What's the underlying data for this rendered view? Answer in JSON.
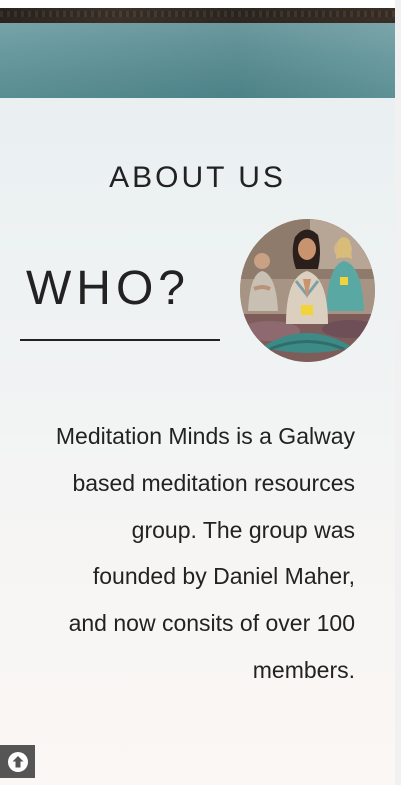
{
  "about": {
    "section_title": "ABOUT US",
    "heading": "WHO?",
    "paragraph": "Meditation Minds is a Galway based meditation resources group. The group was founded by Daniel Maher, and now consits of over 100 members."
  },
  "photo": {
    "subject": "group-meditation-photo"
  },
  "controls": {
    "back_to_top_icon": "arrow-up-circle-icon"
  },
  "colors": {
    "text": "#222222",
    "banner_teal": "#5f9398",
    "banner_dark": "#2f2822",
    "back_to_top_bg": "#555555"
  }
}
